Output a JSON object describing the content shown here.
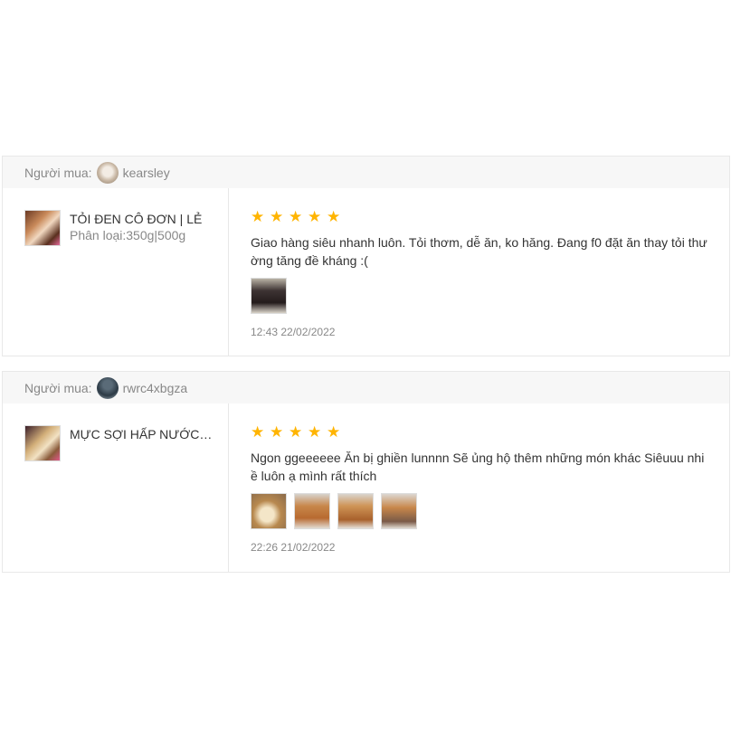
{
  "reviews": [
    {
      "buyer_label": "Người mua:",
      "buyer_name": "kearsley",
      "product_name": "TỎI ĐEN CÔ ĐƠN | LẺ",
      "product_variant": "Phân loại:350g|500g",
      "stars": [
        "★",
        "★",
        "★",
        "★",
        "★"
      ],
      "text": "Giao hàng siêu nhanh luôn. Tỏi thơm, dễ ăn, ko hăng. Đang f0 đặt ăn thay tỏi thư ờng tăng đề kháng :(",
      "photo_count": 1,
      "timestamp": "12:43 22/02/2022"
    },
    {
      "buyer_label": "Người mua:",
      "buyer_name": "rwrc4xbgza",
      "product_name": "MỰC SỢI HẤP NƯỚC DỪA",
      "product_variant": "",
      "stars": [
        "★",
        "★",
        "★",
        "★",
        "★"
      ],
      "text": "Ngon ggeeeeee Ăn bị ghiền lunnnn Sẽ ủng hộ thêm những món khác Siêuuu nhi ề luôn ạ mình rất thích",
      "photo_count": 4,
      "timestamp": "22:26 21/02/2022"
    }
  ],
  "colors": {
    "star": "#ffb400",
    "header_bg": "#f7f7f7",
    "muted_text": "#888888"
  }
}
